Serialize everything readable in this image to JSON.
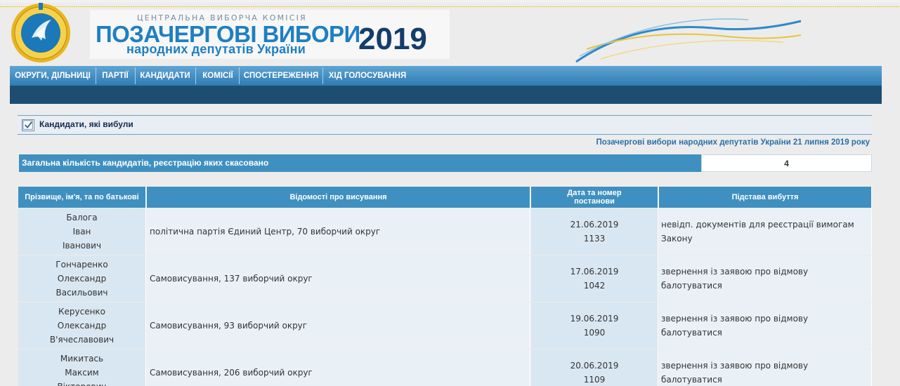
{
  "header": {
    "commission": "ЦЕНТРАЛЬНА ВИБОРЧА КОМІСІЯ",
    "title": "ПОЗАЧЕРГОВІ ВИБОРИ",
    "subtitle": "народних депутатів України",
    "year": "2019"
  },
  "nav": {
    "items": [
      {
        "label": "ОКРУГИ, ДІЛЬНИЦІ"
      },
      {
        "label": "ПАРТІЇ"
      },
      {
        "label": "КАНДИДАТИ"
      },
      {
        "label": "КОМІСІЇ"
      },
      {
        "label": "СПОСТЕРЕЖЕННЯ"
      },
      {
        "label": "ХІД ГОЛОСУВАННЯ"
      }
    ]
  },
  "section": {
    "title": "Кандидати, які вибули",
    "election": "Позачергові вибори народних депутатів України 21 липня 2019 року"
  },
  "summary": {
    "label": "Загальна кількість кандидатів, реєстрацію яких скасовано",
    "value": "4"
  },
  "table": {
    "headers": {
      "name": "Прізвище, ім'я, та по батькові",
      "info": "Відомості про висування",
      "date_line1": "Дата та номер",
      "date_line2": "постанови",
      "reason": "Підстава вибуття"
    },
    "rows": [
      {
        "surname": "Балога",
        "first": "Іван",
        "patronymic": "Іванович",
        "info": "політична партія Єдиний Центр, 70 виборчий округ",
        "date": "21.06.2019",
        "number": "1133",
        "reason": "невідп. документів для реєстрації вимогам Закону"
      },
      {
        "surname": "Гончаренко",
        "first": "Олександр",
        "patronymic": "Васильович",
        "info": "Самовисування, 137 виборчий округ",
        "date": "17.06.2019",
        "number": "1042",
        "reason": "звернення із заявою про відмову балотуватися"
      },
      {
        "surname": "Керусенко",
        "first": "Олександр",
        "patronymic": "В'ячеславович",
        "info": "Самовисування, 93 виборчий округ",
        "date": "19.06.2019",
        "number": "1090",
        "reason": "звернення із заявою про відмову балотуватися"
      },
      {
        "surname": "Микитась",
        "first": "Максим",
        "patronymic": "Вікторович",
        "info": "Самовисування, 206 виборчий округ",
        "date": "20.06.2019",
        "number": "1109",
        "reason": "звернення із заявою про відмову балотуватися"
      }
    ]
  }
}
